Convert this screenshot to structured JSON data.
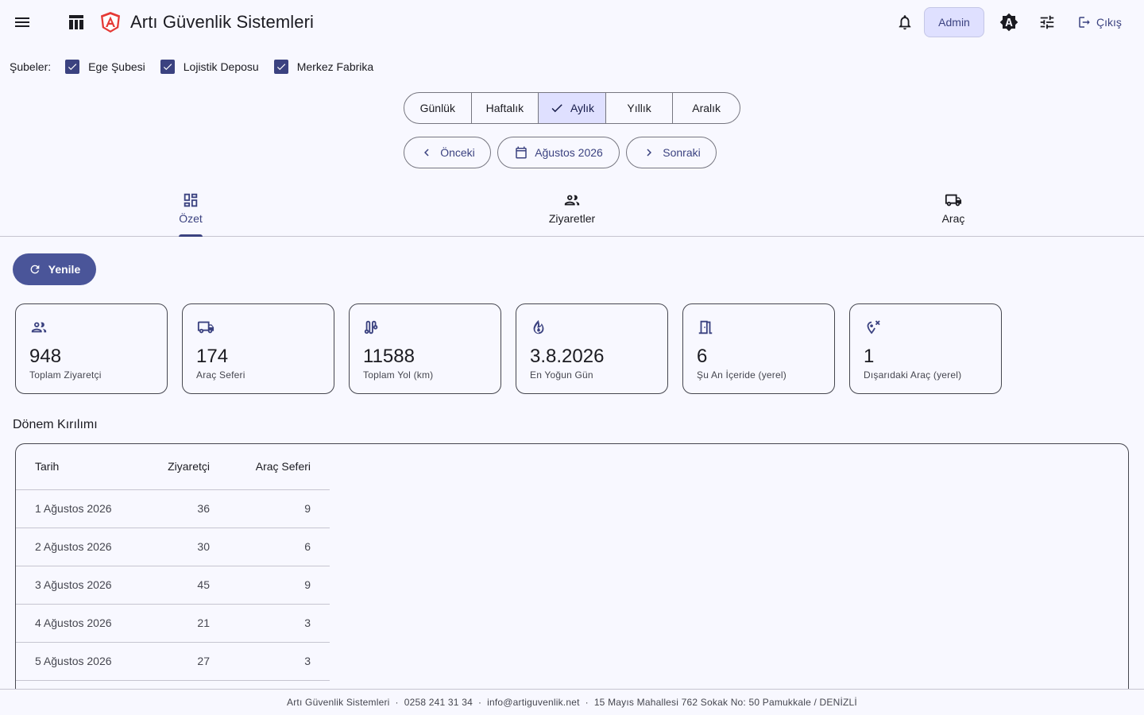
{
  "app": {
    "title": "Artı Güvenlik Sistemleri"
  },
  "header": {
    "admin_label": "Admin",
    "logout_label": "Çıkış"
  },
  "branches": {
    "label": "Şubeler:",
    "items": [
      {
        "label": "Ege Şubesi",
        "checked": true
      },
      {
        "label": "Lojistik Deposu",
        "checked": true
      },
      {
        "label": "Merkez Fabrika",
        "checked": true
      }
    ]
  },
  "period": {
    "options": [
      "Günlük",
      "Haftalık",
      "Aylık",
      "Yıllık",
      "Aralık"
    ],
    "selected": "Aylık"
  },
  "navigation": {
    "prev_label": "Önceki",
    "current_label": "Ağustos 2026",
    "next_label": "Sonraki"
  },
  "tabs": [
    {
      "label": "Özet",
      "icon": "dashboard-icon",
      "active": true
    },
    {
      "label": "Ziyaretler",
      "icon": "people-icon",
      "active": false
    },
    {
      "label": "Araç",
      "icon": "truck-icon",
      "active": false
    }
  ],
  "refresh_label": "Yenile",
  "stats": [
    {
      "value": "948",
      "caption": "Toplam Ziyaretçi",
      "icon": "people-icon"
    },
    {
      "value": "174",
      "caption": "Araç Seferi",
      "icon": "truck-icon"
    },
    {
      "value": "11588",
      "caption": "Toplam Yol (km)",
      "icon": "route-icon"
    },
    {
      "value": "3.8.2026",
      "caption": "En Yoğun Gün",
      "icon": "fire-icon"
    },
    {
      "value": "6",
      "caption": "Şu An İçeride (yerel)",
      "icon": "door-icon"
    },
    {
      "value": "1",
      "caption": "Dışarıdaki Araç (yerel)",
      "icon": "location-off-icon"
    }
  ],
  "breakdown": {
    "title": "Dönem Kırılımı",
    "columns": [
      "Tarih",
      "Ziyaretçi",
      "Araç Seferi"
    ],
    "rows": [
      [
        "1 Ağustos 2026",
        "36",
        "9"
      ],
      [
        "2 Ağustos 2026",
        "30",
        "6"
      ],
      [
        "3 Ağustos 2026",
        "45",
        "9"
      ],
      [
        "4 Ağustos 2026",
        "21",
        "3"
      ],
      [
        "5 Ağustos 2026",
        "27",
        "3"
      ]
    ]
  },
  "footer": {
    "company": "Artı Güvenlik Sistemleri",
    "phone": "0258 241 31 34",
    "email": "info@artiguvenlik.net",
    "address": "15 Mayıs Mahallesi 762 Sokak No: 50 Pamukkale / DENİZLİ",
    "separator": "·"
  },
  "colors": {
    "primary": "#3b4280",
    "primary_container": "#dfe0ff",
    "background": "#f8f8ff",
    "logo_red": "#e53935"
  }
}
